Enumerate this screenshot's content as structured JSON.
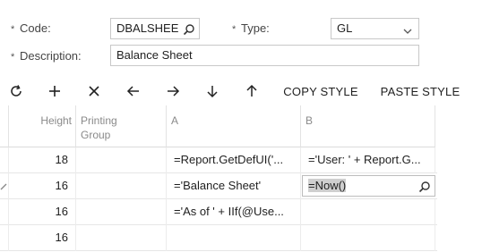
{
  "form": {
    "code_label": "Code:",
    "code_value": "DBALSHEE",
    "type_label": "Type:",
    "type_value": "GL",
    "description_label": "Description:",
    "description_value": "Balance Sheet",
    "required_mark": "*"
  },
  "toolbar": {
    "icons": [
      "refresh-icon",
      "add-icon",
      "delete-icon",
      "arrow-left-icon",
      "arrow-right-icon",
      "arrow-down-icon",
      "arrow-up-icon"
    ],
    "copy_style_label": "COPY STYLE",
    "paste_style_label": "PASTE STYLE"
  },
  "grid": {
    "columns": [
      "Height",
      "Printing Group",
      "A",
      "B"
    ],
    "rows": [
      {
        "height": "18",
        "printing_group": "",
        "a": "=Report.GetDefUI('...",
        "b": "='User: ' + Report.G..."
      },
      {
        "height": "16",
        "printing_group": "",
        "a": "='Balance Sheet'",
        "b": "=Now()"
      },
      {
        "height": "16",
        "printing_group": "",
        "a": "='As of ' + IIf(@Use...",
        "b": ""
      },
      {
        "height": "16",
        "printing_group": "",
        "a": "",
        "b": ""
      }
    ]
  }
}
